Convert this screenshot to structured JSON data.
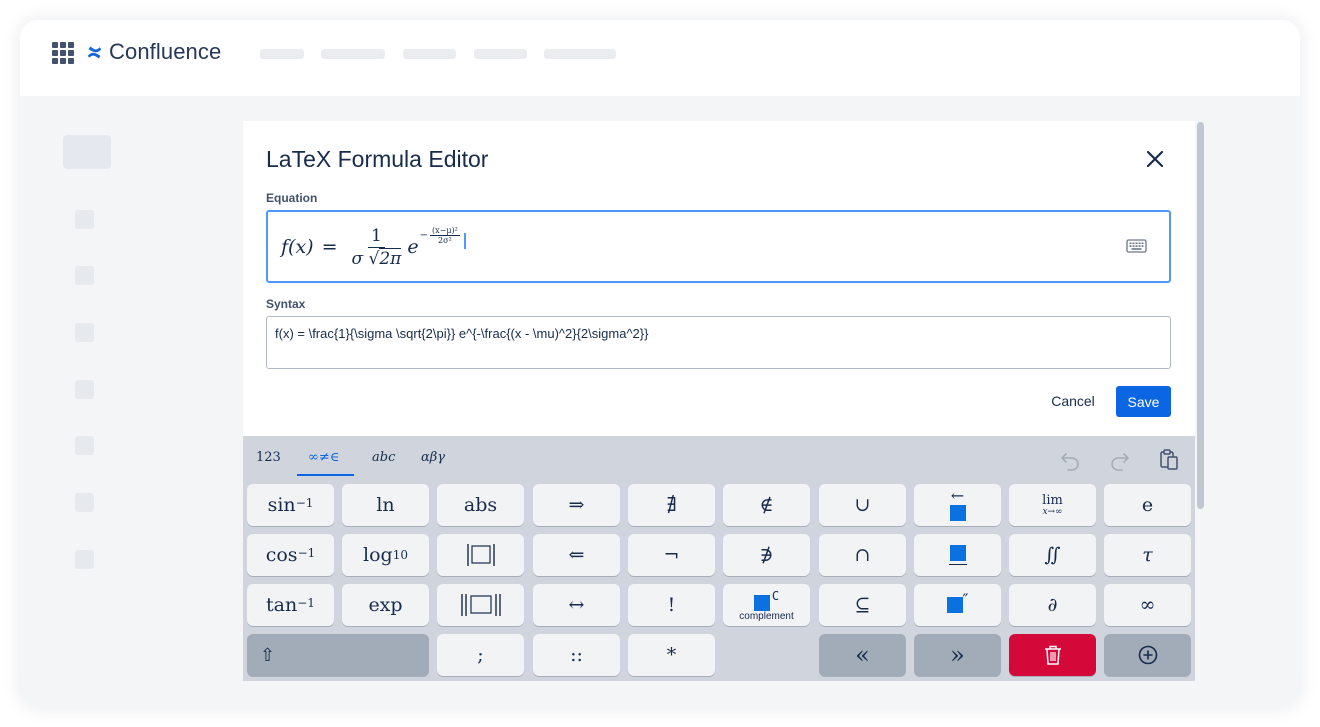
{
  "app": {
    "name": "Confluence"
  },
  "dialog": {
    "title": "LaTeX Formula Editor",
    "equation_label": "Equation",
    "syntax_label": "Syntax",
    "syntax_value": "f(x) = \\frac{1}{\\sigma \\sqrt{2\\pi}} e^{-\\frac{(x - \\mu)^2}{2\\sigma^2}}",
    "cancel_label": "Cancel",
    "save_label": "Save"
  },
  "formula": {
    "lhs": "f(x)",
    "eq": "=",
    "numerator": "1",
    "sigma": "σ",
    "sqrt_sym": "√",
    "sqrt_arg": "2π",
    "base": "e",
    "exp_minus": "−",
    "exp_num": "(x−μ)²",
    "exp_den": "2σ²"
  },
  "keyboard": {
    "tabs": [
      {
        "label": "123",
        "active": false
      },
      {
        "label": "∞≠∈",
        "active": true
      },
      {
        "label": "abc",
        "active": false
      },
      {
        "label": "αβγ",
        "active": false
      }
    ],
    "tools": [
      "undo-icon",
      "redo-icon",
      "clipboard-icon"
    ],
    "rows": [
      [
        "sin⁻¹",
        "ln",
        "abs",
        "⇒",
        "∄",
        "∉",
        "∪",
        "←□",
        "lim x→∞",
        "e"
      ],
      [
        "cos⁻¹",
        "log₁₀",
        "|□|",
        "⇐",
        "¬",
        "∌",
        "∩",
        "□ underline",
        "∬",
        "τ"
      ],
      [
        "tan⁻¹",
        "exp",
        "||□||",
        "↔",
        "!",
        "□ᶜ complement",
        "⊆",
        "□″",
        "∂",
        "∞"
      ],
      [
        "shift",
        ";",
        "::",
        "*",
        "«",
        "»",
        "delete",
        "add"
      ]
    ],
    "keys": {
      "sin": "sin",
      "sup_minus1": "−1",
      "cos": "cos",
      "tan": "tan",
      "ln": "ln",
      "log": "log",
      "log_sub": "10",
      "abs": "abs",
      "exp": "exp",
      "implies": "⇒",
      "implied_by": "⇐",
      "iff": "↔",
      "not_exists": "∄",
      "not": "¬",
      "factorial": "!",
      "not_in": "∉",
      "not_ni": "∌",
      "union": "∪",
      "intersection": "∩",
      "subseteq": "⊆",
      "left_arrow": "←",
      "double_prime": "″",
      "lim": "lim",
      "lim_sub": "x→∞",
      "double_integral": "∬",
      "partial": "∂",
      "e": "e",
      "tau": "τ",
      "infinity": "∞",
      "complement_sup": "C",
      "complement_label": "complement",
      "semicolon": ";",
      "double_colon": "::",
      "asterisk": "*",
      "move_left": "«",
      "move_right": "»",
      "shift": "⇧"
    }
  },
  "colors": {
    "brand": "#0c66e4",
    "focus": "#4c9aff",
    "delete": "#d4093a",
    "keyboard_bg": "#d0d5dd",
    "key_bg": "#f2f3f5",
    "key_dark": "#a2abb8"
  }
}
